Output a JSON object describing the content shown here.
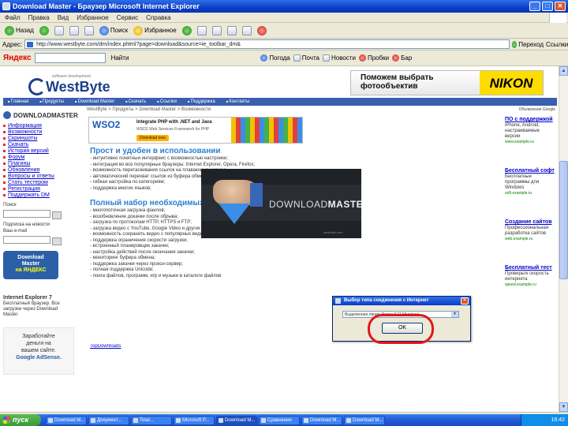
{
  "window": {
    "title": "Download Master - Браузер Microsoft Internet Explorer",
    "min": "_",
    "max": "□",
    "close": "✕"
  },
  "menu": [
    "Файл",
    "Правка",
    "Вид",
    "Избранное",
    "Сервис",
    "Справка"
  ],
  "toolbar": {
    "back": "Назад",
    "search": "Поиск",
    "favorites": "Избранное"
  },
  "address": {
    "label": "Адрес:",
    "url": "http://www.westbyte.com/dm/index.phtml?page=download&source=ie_toolbar_dm&",
    "go": "Переход",
    "links": "Ссылки"
  },
  "yandex_bar": {
    "logo": "Яндекс",
    "find": "Найти",
    "items": [
      "Погода",
      "Почта",
      "Новости",
      "Пробки",
      "Бар"
    ]
  },
  "site": {
    "tagline": "software development",
    "brand": "WestByte",
    "ad_text": "Поможем выбрать фотообъектив",
    "ad_brand": "NIKON",
    "nav": [
      "Главная",
      "Продукты",
      "Download Master",
      "Скачать",
      "Ссылки",
      "Поддержка",
      "Контакты"
    ],
    "sidebar_title": "DOWNLOADMASTER",
    "sidebar_links": [
      "Информация",
      "Возможности",
      "Скриншоты",
      "Скачать",
      "История версий",
      "Форум",
      "Плагины",
      "Обновления",
      "Вопросы и ответы",
      "Стать тестером",
      "Регистрация",
      "Поддержать DM"
    ],
    "sidebar_small": [
      "Поиск",
      "Подписка на новости",
      "Ваш e-mail"
    ],
    "dm_box_line1": "Download",
    "dm_box_line2": "Master",
    "dm_box_line3": "на ЯНДЕКС",
    "ie_ad_title": "Internet Explorer 7",
    "ie_ad_body": "Бесплатный браузер. Все загрузки через Download Master.",
    "adsense_line1": "Заработайте",
    "adsense_line2": "деньги на",
    "adsense_line3": "вашем сайте.",
    "adsense_brand": "Google AdSense.",
    "breadcrumb": "WestByte > Продукты > Download Master > Возможности",
    "ws_banner_logo": "WSO2",
    "ws_banner_t1": "Integrate PHP with .NET and Java",
    "ws_banner_t2": "WSO2 Web Services Framework for PHP",
    "ws_banner_btn": "Download now",
    "sec1": "Прост и удобен в использовании",
    "para1": "- интуитивно понятный интерфейс с возможностью настройки;\n- интеграция во все популярные браузеры: Internet Explorer, Opera, Firefox;\n- возможность перетаскивания ссылок на плавающую иконку;\n- автоматический перехват ссылок из буфера обмена;\n- гибкая настройка по категориям;\n- поддержка многих языков;",
    "sec2": "Полный набор необходимых функций",
    "para2": "- многопоточная загрузка файлов;\n- возобновление докачки после обрыва;\n- загрузка по протоколам HTTP, HTTPS и FTP;\n- загрузка видео с YouTube, Google Video и других сервисов;\n- возможность сохранить видео с популярных видеосервисов;\n- поддержка ограничения скорости загрузки;\n- встроенный планировщик закачек;\n- настройка действий после окончания закачки;\n- мониторинг буфера обмена;\n- поддержка закачки через прокси-сервер;\n- полная поддержка Unicode;\n- поиск файлов, программ, игр и музыки в каталоге файлов",
    "top_downloads": "TopDownloads",
    "right_gads": "Объявления Google",
    "right_ads": [
      {
        "h": "ПО с поддержкой",
        "b": "iPhone, Android, настраиваемые версии",
        "u": "www.example.ru"
      },
      {
        "h": "Бесплатный софт",
        "b": "Бесплатные программы для Windows",
        "u": "soft.example.ru"
      },
      {
        "h": "Создание сайтов",
        "b": "Профессиональная разработка сайтов",
        "u": "web.example.ru"
      },
      {
        "h": "Бесплатный тест",
        "b": "Проверьте скорость интернета",
        "u": "speed.example.ru"
      }
    ]
  },
  "splash": {
    "brand_a": "DOWNLOAD",
    "brand_b": "MASTER",
    "small": "westbyte.com"
  },
  "dialog": {
    "title": "Выбор типа соединения с Интернет",
    "selected": "Выделенная линия (более 512 Кбит/сек)",
    "ok": "OK"
  },
  "taskbar": {
    "start": "пуск",
    "tasks": [
      "Download M...",
      "Документ...",
      "Total...",
      "Microsoft P...",
      "Download M...",
      "Сравнение",
      "Download M...",
      "Download M..."
    ],
    "clock": "16:42"
  }
}
